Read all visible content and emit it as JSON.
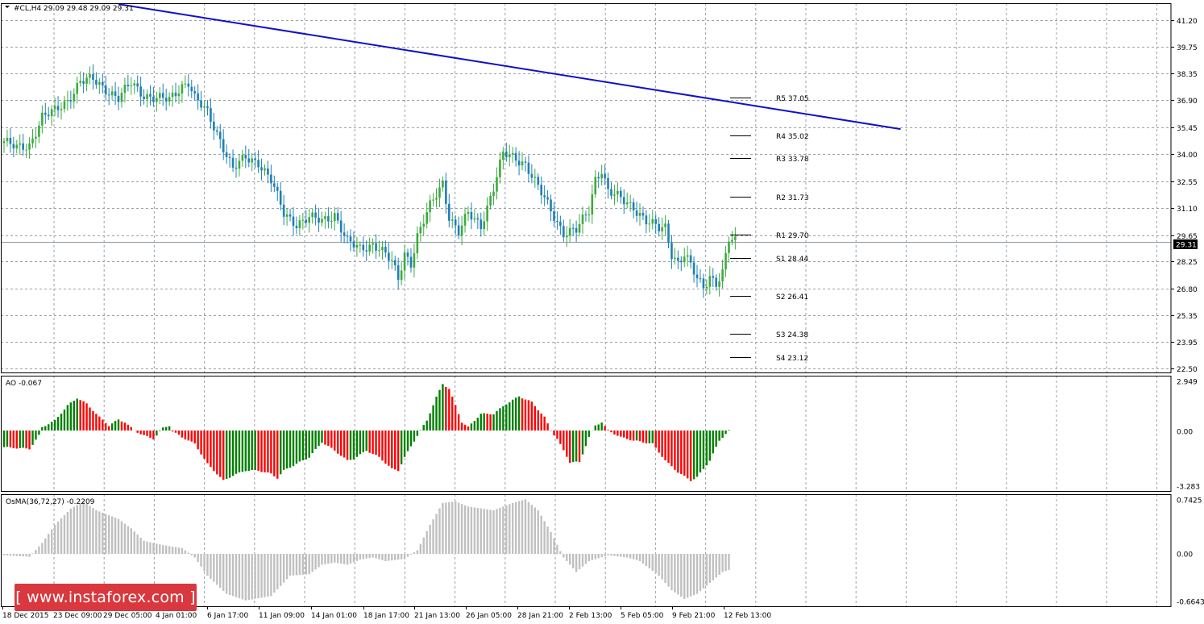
{
  "watermark": "[ www.instaforex.com ]",
  "colors": {
    "bull": "#3cab3c",
    "bear": "#1e7fb8",
    "trendline": "#1010c8",
    "ao_up": "#008000",
    "ao_down": "#ff0000",
    "osma": "#c0c0c0",
    "grid": "#9aa0a8",
    "level": "#000000"
  },
  "chart_data": [
    {
      "type": "candlestick",
      "header": "#CL,H4  29.09 29.48 29.09 29.31",
      "symbol": "#CL,H4",
      "ohlc_last": [
        29.09,
        29.48,
        29.09,
        29.31
      ],
      "current_price": "29.31",
      "y_ticks": [
        "41.20",
        "39.75",
        "38.35",
        "36.90",
        "35.45",
        "34.00",
        "32.55",
        "31.10",
        "29.65",
        "28.25",
        "26.80",
        "25.35",
        "23.95",
        "22.50"
      ],
      "ylim": [
        22.3,
        42.1
      ],
      "x_ticks": [
        "18 Dec 2015",
        "23 Dec 09:00",
        "29 Dec 05:00",
        "4 Jan 01:00",
        "6 Jan 17:00",
        "11 Jan 09:00",
        "14 Jan 01:00",
        "18 Jan 17:00",
        "21 Jan 13:00",
        "26 Jan 05:00",
        "28 Jan 21:00",
        "2 Feb 13:00",
        "5 Feb 05:00",
        "9 Feb 21:00",
        "12 Feb 13:00"
      ],
      "close_path": [
        [
          0,
          34.7
        ],
        [
          4,
          34.3
        ],
        [
          8,
          34.5
        ],
        [
          12,
          36.0
        ],
        [
          16,
          36.3
        ],
        [
          20,
          36.9
        ],
        [
          24,
          37.9
        ],
        [
          28,
          38.0
        ],
        [
          32,
          37.5
        ],
        [
          36,
          37.0
        ],
        [
          40,
          37.8
        ],
        [
          44,
          37.2
        ],
        [
          48,
          37.0
        ],
        [
          52,
          36.9
        ],
        [
          56,
          37.7
        ],
        [
          58,
          37.9
        ],
        [
          60,
          37.0
        ],
        [
          64,
          36.2
        ],
        [
          68,
          34.8
        ],
        [
          72,
          33.2
        ],
        [
          76,
          33.8
        ],
        [
          80,
          33.6
        ],
        [
          84,
          32.6
        ],
        [
          88,
          30.8
        ],
        [
          92,
          30.3
        ],
        [
          96,
          30.6
        ],
        [
          100,
          30.4
        ],
        [
          104,
          30.8
        ],
        [
          108,
          29.3
        ],
        [
          112,
          28.9
        ],
        [
          116,
          29.2
        ],
        [
          118,
          29.0
        ],
        [
          122,
          28.2
        ],
        [
          124,
          27.3
        ],
        [
          126,
          28.7
        ],
        [
          128,
          28.2
        ],
        [
          130,
          29.6
        ],
        [
          134,
          31.2
        ],
        [
          138,
          32.5
        ],
        [
          140,
          30.7
        ],
        [
          143,
          29.8
        ],
        [
          146,
          30.8
        ],
        [
          150,
          30.2
        ],
        [
          154,
          32.2
        ],
        [
          157,
          34.0
        ],
        [
          161,
          33.8
        ],
        [
          164,
          33.5
        ],
        [
          168,
          32.2
        ],
        [
          172,
          31.0
        ],
        [
          176,
          29.8
        ],
        [
          180,
          29.9
        ],
        [
          184,
          31.0
        ],
        [
          186,
          32.7
        ],
        [
          188,
          33.2
        ],
        [
          190,
          32.0
        ],
        [
          194,
          31.6
        ],
        [
          198,
          31.2
        ],
        [
          202,
          30.4
        ],
        [
          206,
          30.0
        ],
        [
          208,
          30.1
        ],
        [
          210,
          28.7
        ],
        [
          212,
          28.2
        ],
        [
          214,
          28.6
        ],
        [
          216,
          28.0
        ],
        [
          218,
          27.3
        ],
        [
          220,
          26.9
        ],
        [
          222,
          27.5
        ],
        [
          224,
          27.1
        ],
        [
          226,
          27.6
        ],
        [
          228,
          29.4
        ],
        [
          230,
          29.3
        ]
      ],
      "pivot_levels": [
        {
          "label": "R5 37.05",
          "value": 37.05
        },
        {
          "label": "R4 35.02",
          "value": 35.02
        },
        {
          "label": "R3 33.78",
          "value": 33.78
        },
        {
          "label": "R2 31.73",
          "value": 31.73
        },
        {
          "label": "R1 29.70",
          "value": 29.7
        },
        {
          "label": "S1 28.44",
          "value": 28.44
        },
        {
          "label": "S2 26.41",
          "value": 26.41
        },
        {
          "label": "S3 24.38",
          "value": 24.38
        },
        {
          "label": "S4 23.12",
          "value": 23.12
        }
      ],
      "trendline": {
        "from": [
          36,
          42.05
        ],
        "to": [
          282,
          35.35
        ]
      }
    },
    {
      "type": "histogram",
      "header": "AO -0.067",
      "y_ticks": [
        "2.949",
        "0.00",
        "-3.283"
      ],
      "ylim": [
        -3.283,
        2.949
      ],
      "path": [
        [
          0,
          -1.0
        ],
        [
          8,
          -1.1
        ],
        [
          11,
          -0.3
        ],
        [
          12,
          0.2
        ],
        [
          16,
          0.6
        ],
        [
          20,
          1.5
        ],
        [
          23,
          1.95
        ],
        [
          26,
          1.6
        ],
        [
          30,
          0.8
        ],
        [
          33,
          0.3
        ],
        [
          36,
          0.65
        ],
        [
          38,
          0.5
        ],
        [
          41,
          0.0
        ],
        [
          44,
          -0.3
        ],
        [
          47,
          -0.5
        ],
        [
          50,
          0.15
        ],
        [
          52,
          0.3
        ],
        [
          53,
          -0.05
        ],
        [
          56,
          -0.4
        ],
        [
          60,
          -0.8
        ],
        [
          64,
          -2.0
        ],
        [
          69,
          -3.0
        ],
        [
          72,
          -2.7
        ],
        [
          76,
          -2.4
        ],
        [
          80,
          -2.4
        ],
        [
          84,
          -2.6
        ],
        [
          86,
          -2.85
        ],
        [
          88,
          -2.4
        ],
        [
          92,
          -2.0
        ],
        [
          96,
          -1.6
        ],
        [
          100,
          -0.7
        ],
        [
          104,
          -1.2
        ],
        [
          108,
          -1.8
        ],
        [
          110,
          -1.7
        ],
        [
          114,
          -1.2
        ],
        [
          118,
          -1.6
        ],
        [
          122,
          -2.3
        ],
        [
          124,
          -2.4
        ],
        [
          126,
          -1.6
        ],
        [
          130,
          -0.3
        ],
        [
          133,
          0.6
        ],
        [
          136,
          2.0
        ],
        [
          138,
          2.8
        ],
        [
          140,
          2.5
        ],
        [
          144,
          0.5
        ],
        [
          146,
          0.2
        ],
        [
          150,
          1.0
        ],
        [
          154,
          1.0
        ],
        [
          158,
          1.6
        ],
        [
          162,
          2.05
        ],
        [
          166,
          1.7
        ],
        [
          170,
          0.8
        ],
        [
          172,
          0.0
        ],
        [
          174,
          -0.5
        ],
        [
          178,
          -1.9
        ],
        [
          181,
          -1.9
        ],
        [
          184,
          -0.4
        ],
        [
          186,
          0.3
        ],
        [
          188,
          0.5
        ],
        [
          190,
          0.0
        ],
        [
          194,
          -0.4
        ],
        [
          198,
          -0.6
        ],
        [
          204,
          -0.8
        ],
        [
          208,
          -1.8
        ],
        [
          212,
          -2.5
        ],
        [
          216,
          -3.0
        ],
        [
          218,
          -2.8
        ],
        [
          222,
          -1.8
        ],
        [
          225,
          -0.6
        ],
        [
          228,
          0.0
        ]
      ]
    },
    {
      "type": "histogram",
      "header": "OsMA(36,72,27) -0.2209",
      "y_ticks": [
        "0.7425",
        "0.00",
        "-0.6643"
      ],
      "ylim": [
        -0.6643,
        0.7425
      ],
      "path": [
        [
          0,
          -0.02
        ],
        [
          8,
          -0.04
        ],
        [
          12,
          0.15
        ],
        [
          16,
          0.4
        ],
        [
          21,
          0.62
        ],
        [
          25,
          0.72
        ],
        [
          29,
          0.6
        ],
        [
          36,
          0.48
        ],
        [
          40,
          0.35
        ],
        [
          44,
          0.18
        ],
        [
          50,
          0.12
        ],
        [
          56,
          0.08
        ],
        [
          60,
          -0.05
        ],
        [
          64,
          -0.3
        ],
        [
          70,
          -0.55
        ],
        [
          76,
          -0.64
        ],
        [
          84,
          -0.58
        ],
        [
          90,
          -0.3
        ],
        [
          96,
          -0.28
        ],
        [
          100,
          -0.15
        ],
        [
          104,
          -0.12
        ],
        [
          108,
          -0.15
        ],
        [
          112,
          -0.08
        ],
        [
          116,
          -0.05
        ],
        [
          120,
          -0.1
        ],
        [
          126,
          -0.07
        ],
        [
          130,
          0.05
        ],
        [
          134,
          0.4
        ],
        [
          138,
          0.7
        ],
        [
          142,
          0.72
        ],
        [
          146,
          0.65
        ],
        [
          154,
          0.6
        ],
        [
          160,
          0.7
        ],
        [
          164,
          0.75
        ],
        [
          168,
          0.6
        ],
        [
          172,
          0.3
        ],
        [
          176,
          -0.05
        ],
        [
          180,
          -0.25
        ],
        [
          184,
          -0.1
        ],
        [
          190,
          -0.02
        ],
        [
          196,
          -0.05
        ],
        [
          200,
          -0.1
        ],
        [
          206,
          -0.3
        ],
        [
          210,
          -0.5
        ],
        [
          214,
          -0.62
        ],
        [
          218,
          -0.55
        ],
        [
          222,
          -0.4
        ],
        [
          226,
          -0.25
        ],
        [
          228,
          -0.22
        ]
      ]
    }
  ]
}
